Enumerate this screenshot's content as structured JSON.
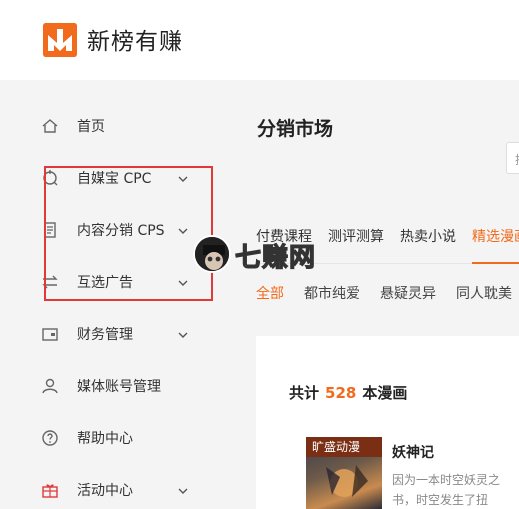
{
  "header": {
    "brand": "新榜有赚"
  },
  "sidebar": {
    "items": [
      {
        "label": "首页",
        "icon": "home-icon",
        "has_chevron": false
      },
      {
        "label": "自媒宝 CPC",
        "icon": "refresh-icon",
        "has_chevron": true
      },
      {
        "label": "内容分销 CPS",
        "icon": "document-icon",
        "has_chevron": true
      },
      {
        "label": "互选广告",
        "icon": "exchange-icon",
        "has_chevron": true
      },
      {
        "label": "财务管理",
        "icon": "wallet-icon",
        "has_chevron": true
      },
      {
        "label": "媒体账号管理",
        "icon": "user-icon",
        "has_chevron": false
      },
      {
        "label": "帮助中心",
        "icon": "help-icon",
        "has_chevron": false
      },
      {
        "label": "活动中心",
        "icon": "gift-icon",
        "has_chevron": true
      }
    ]
  },
  "main": {
    "title": "分销市场",
    "search_stub": "搜",
    "tabs": [
      "付费课程",
      "测评测算",
      "热卖小说",
      "精选漫画"
    ],
    "active_tab": 3,
    "subtabs": [
      "全部",
      "都市纯爱",
      "悬疑灵异",
      "同人耽美"
    ],
    "active_subtab": 0,
    "count_prefix": "共计",
    "count": "528",
    "count_suffix": "本漫画",
    "book": {
      "badge": "旷盛动漫",
      "title": "妖神记",
      "desc": "因为一本时空妖灵之书，时空发生了扭"
    }
  },
  "watermark": {
    "text": "七赚网"
  },
  "colors": {
    "accent": "#f26a1b",
    "highlight": "#e0393a"
  }
}
